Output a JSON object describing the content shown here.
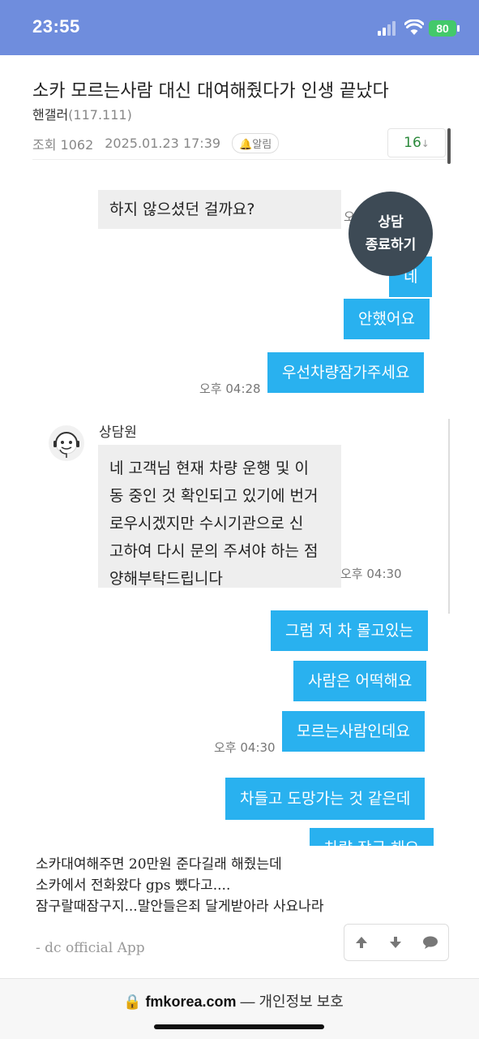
{
  "status_bar": {
    "time": "23:55",
    "battery": "80"
  },
  "post": {
    "title": "소카 모르는사람 대신 대여해줬다가 인생 끝났다",
    "author": "핸갤러",
    "author_ip": "(117.111)",
    "views": "조회 1062",
    "date": "2025.01.23 17:39",
    "alarm": "알림",
    "comment_count": "16"
  },
  "chat": {
    "consult_end_line1": "상담",
    "consult_end_line2": "종료하기",
    "messages_top": {
      "partial_in": "하지 않으셨던 걸까요?",
      "out_1": "네",
      "out_2": "안했어요",
      "out_3": "우선차량잠가주세요",
      "time_1": "오후 04:28",
      "partial_time": "오"
    },
    "counselor": {
      "name": "상담원",
      "message": "네 고객님 현재 차량 운행 및 이\n동 중인 것 확인되고 있기에 번거\n로우시겠지만 수시기관으로 신\n고하여 다시 문의 주셔야 하는 점\n양해부탁드립니다",
      "time": "오후 04:30"
    },
    "messages_bottom": {
      "out_4": "그럼 저 차 몰고있는",
      "out_5": "사람은 어떡해요",
      "out_6": "모르는사람인데요",
      "time_2": "오후 04:30",
      "out_7": "차들고 도망가는 것 같은데",
      "out_8": "차량 잠금 해요"
    }
  },
  "caption": {
    "line1": "소카대여해주면 20만원 준다길래 해줬는데",
    "line2": "소카에서 전화왔다 gps 뺐다고....",
    "line3": "잠구랄때잠구지...말안들은죄 달게받아라 사요나라",
    "signature": "- dc official App"
  },
  "footer": {
    "domain": "fmkorea.com",
    "privacy": "— 개인정보 보호"
  }
}
